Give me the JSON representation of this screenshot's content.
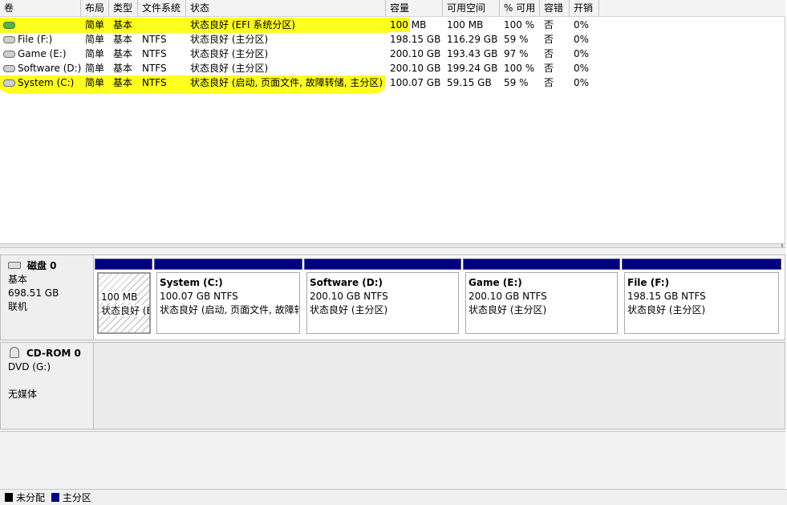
{
  "columns": [
    "卷",
    "布局",
    "类型",
    "文件系统",
    "状态",
    "容量",
    "可用空间",
    "% 可用",
    "容错",
    "开销"
  ],
  "volumes": [
    {
      "name": "",
      "layout": "简单",
      "type": "基本",
      "fs": "",
      "status": "状态良好 (EFI 系统分区)",
      "capacity": "100 MB",
      "free": "100 MB",
      "pct_free": "100 %",
      "fault_tolerance": "否",
      "overhead": "0%"
    },
    {
      "name": "File (F:)",
      "layout": "简单",
      "type": "基本",
      "fs": "NTFS",
      "status": "状态良好 (主分区)",
      "capacity": "198.15 GB",
      "free": "116.29 GB",
      "pct_free": "59 %",
      "fault_tolerance": "否",
      "overhead": "0%"
    },
    {
      "name": "Game (E:)",
      "layout": "简单",
      "type": "基本",
      "fs": "NTFS",
      "status": "状态良好 (主分区)",
      "capacity": "200.10 GB",
      "free": "193.43 GB",
      "pct_free": "97 %",
      "fault_tolerance": "否",
      "overhead": "0%"
    },
    {
      "name": "Software (D:)",
      "layout": "简单",
      "type": "基本",
      "fs": "NTFS",
      "status": "状态良好 (主分区)",
      "capacity": "200.10 GB",
      "free": "199.24 GB",
      "pct_free": "100 %",
      "fault_tolerance": "否",
      "overhead": "0%"
    },
    {
      "name": "System (C:)",
      "layout": "简单",
      "type": "基本",
      "fs": "NTFS",
      "status": "状态良好 (启动, 页面文件, 故障转储, 主分区)",
      "capacity": "100.07 GB",
      "free": "59.15 GB",
      "pct_free": "59 %",
      "fault_tolerance": "否",
      "overhead": "0%"
    }
  ],
  "disks": [
    {
      "name": "磁盘 0",
      "type": "基本",
      "size": "698.51 GB",
      "state": "联机",
      "partitions": [
        {
          "name": "",
          "size_fs": "100 MB",
          "status": "状态良好 (EFI 系统分区)"
        },
        {
          "name": "System  (C:)",
          "size_fs": "100.07 GB NTFS",
          "status": "状态良好 (启动, 页面文件, 故障转储, 主分区)"
        },
        {
          "name": "Software  (D:)",
          "size_fs": "200.10 GB NTFS",
          "status": "状态良好 (主分区)"
        },
        {
          "name": "Game  (E:)",
          "size_fs": "200.10 GB NTFS",
          "status": "状态良好 (主分区)"
        },
        {
          "name": "File  (F:)",
          "size_fs": "198.15 GB NTFS",
          "status": "状态良好 (主分区)"
        }
      ]
    },
    {
      "name": "CD-ROM 0",
      "type": "DVD (G:)",
      "state": "无媒体"
    }
  ],
  "legend": [
    {
      "label": "未分配",
      "color": "#000000"
    },
    {
      "label": "主分区",
      "color": "#000080"
    }
  ],
  "colors": {
    "highlight": "#ffff1f",
    "primary_partition": "#000080",
    "unallocated": "#000000"
  },
  "icons": {
    "volume": "volume-icon",
    "efi_volume": "volume-icon-green",
    "disk": "disk-icon",
    "cdrom": "cdrom-icon"
  }
}
